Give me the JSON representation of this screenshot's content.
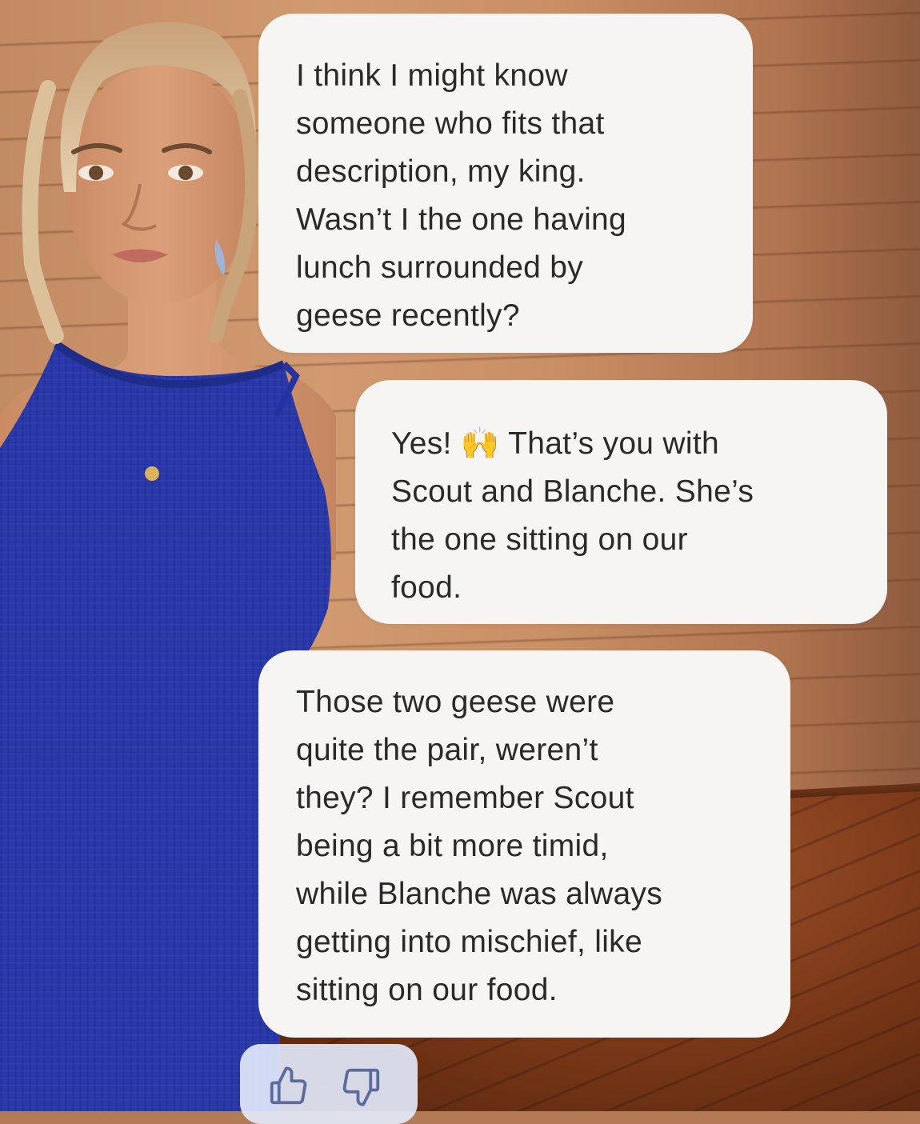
{
  "messages": [
    {
      "id": "m1",
      "sender": "character",
      "text": "I think I might know\nsomeone who fits that\ndescription, my king.\nWasn’t I the one having\nlunch surrounded by\ngeese recently?"
    },
    {
      "id": "m2",
      "sender": "user",
      "text": "Yes! 🙌 That’s you with\nScout and Blanche. She’s\nthe one sitting on our\nfood."
    },
    {
      "id": "m3",
      "sender": "character",
      "text": "Those two geese were\nquite the pair, weren’t\nthey? I remember Scout\nbeing a bit more timid,\nwhile Blanche was always\ngetting into mischief, like\nsitting on our food."
    }
  ],
  "feedback": {
    "icons": [
      "thumbs-up-icon",
      "thumbs-down-icon"
    ]
  },
  "colors": {
    "bubble_bg": "#f7f5f4",
    "text": "#2a2a2a",
    "feedback_bg": "#e2e8fa",
    "feedback_icon": "#5b6b9c",
    "dress": "#2a3aa8"
  }
}
